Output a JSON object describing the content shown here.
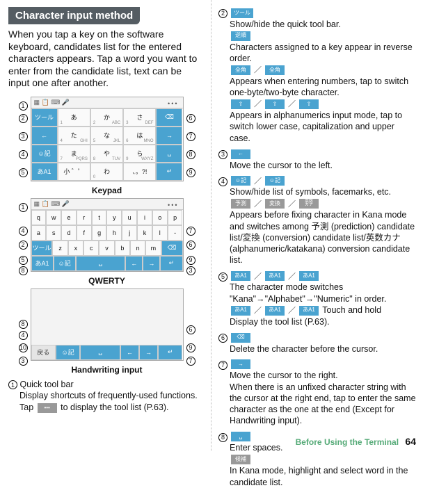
{
  "section_title": "Character input method",
  "intro": "When you tap a key on the software keyboard, candidates list for the entered characters appears. Tap a word you want to enter from the candidate list, text can be input one after another.",
  "kb_labels": {
    "keypad": "Keypad",
    "qwerty": "QWERTY",
    "handwriting": "Handwriting input"
  },
  "callouts": {
    "c1": "1",
    "c2": "2",
    "c3": "3",
    "c4": "4",
    "c5": "5",
    "c6": "6",
    "c7": "7",
    "c8": "8",
    "c9": "9",
    "c10": "10"
  },
  "keypad": {
    "tool": "ツール",
    "cells": [
      {
        "main": "あ",
        "num": "1",
        "sub": ""
      },
      {
        "main": "か",
        "num": "2",
        "sub": "ABC"
      },
      {
        "main": "さ",
        "num": "3",
        "sub": "DEF"
      },
      {
        "main": "た",
        "num": "4",
        "sub": "GHI"
      },
      {
        "main": "な",
        "num": "5",
        "sub": "JKL"
      },
      {
        "main": "は",
        "num": "6",
        "sub": "MNO"
      },
      {
        "main": "ま",
        "num": "7",
        "sub": "PQRS"
      },
      {
        "main": "や",
        "num": "8",
        "sub": "TUV"
      },
      {
        "main": "ら",
        "num": "9",
        "sub": "WXYZ"
      },
      {
        "main": "小 ゛゜",
        "num": "",
        "sub": ""
      },
      {
        "main": "わ",
        "num": "0",
        "sub": ""
      },
      {
        "main": "、。?!",
        "num": "",
        "sub": ""
      }
    ],
    "side_left": {
      "r1": "ツール",
      "r2": "←",
      "r3": "☺記",
      "r4": "あA1"
    },
    "side_right": {
      "r1": "⌫",
      "r2": "→",
      "r3": "␣",
      "r4": "↵"
    }
  },
  "qwerty": {
    "row1": [
      "q",
      "w",
      "e",
      "r",
      "t",
      "y",
      "u",
      "i",
      "o",
      "p"
    ],
    "row2": [
      "a",
      "s",
      "d",
      "f",
      "g",
      "h",
      "j",
      "k",
      "l",
      "-"
    ],
    "row3_side": "ツール",
    "row3": [
      "z",
      "x",
      "c",
      "v",
      "b",
      "n",
      "m"
    ],
    "row3_del": "⌫",
    "row4": {
      "mode": "あA1",
      "emoji": "☺記",
      "space": "␣",
      "enter": "↵",
      "left": "←",
      "right": "→"
    }
  },
  "hand": {
    "back": "戻る",
    "emoji": "☺記",
    "space": "␣",
    "left": "←",
    "right": "→",
    "enter": "↵",
    "del": "⌫"
  },
  "left_items": {
    "i1_title": "Quick tool bar",
    "i1_body_a": "Display shortcuts of frequently-used functions. Tap ",
    "i1_chip": "•••",
    "i1_body_b": " to display the tool list (P.63)."
  },
  "right_items": {
    "i2": {
      "chip_tool": "ツール",
      "line1": "Show/hide the quick tool bar.",
      "chip_reverse": "逆順",
      "line2": "Characters assigned to a key appear in reverse order.",
      "chip_full": "全角",
      "chip_half": "全角",
      "line3": "Appears when entering numbers, tap to switch one-byte/two-byte character.",
      "chip_shift1": "⇧",
      "chip_shift2": "⇧",
      "chip_shift3": "⇧",
      "line4": "Appears in alphanumerics input mode, tap to switch lower case, capitalization and upper case."
    },
    "i3": {
      "chip": "←",
      "line": "Move the cursor to the left."
    },
    "i4": {
      "chip_emoji1": "☺記",
      "chip_emoji2": "☺記",
      "line1": "Show/hide list of symbols, facemarks, etc.",
      "chip_pred": "予測",
      "chip_conv": "変換",
      "chip_kana": "英数\nカナ",
      "line2": "Appears before fixing character in Kana mode and switches among 予測 (prediction) candidate list/変換 (conversion) candidate list/英数カナ (alphanumeric/katakana) conversion candidate list."
    },
    "i5": {
      "chip_m1": "あA1",
      "chip_m2": "あA1",
      "chip_m3": "あA1",
      "line1": "The character mode switches \"Kana\"→\"Alphabet\"→\"Numeric\" in order.",
      "chip_h1": "あA1",
      "chip_h2": "あA1",
      "chip_h3": "あA1",
      "hold": " Touch and hold",
      "line2": "Display the tool list (P.63)."
    },
    "i6": {
      "chip": "⌫",
      "line": "Delete the character before the cursor."
    },
    "i7": {
      "chip": "→",
      "line": "Move the cursor to the right.\nWhen there is an unfixed character string with the cursor at the right end, tap to enter the same character as the one at the end (Except for Handwriting input)."
    },
    "i8": {
      "chip_space": "␣",
      "line1": "Enter spaces.",
      "chip_cand": "候補",
      "line2": "In Kana mode, highlight and select word in the candidate list."
    }
  },
  "footer": {
    "section": "Before Using the Terminal",
    "page": "64"
  }
}
